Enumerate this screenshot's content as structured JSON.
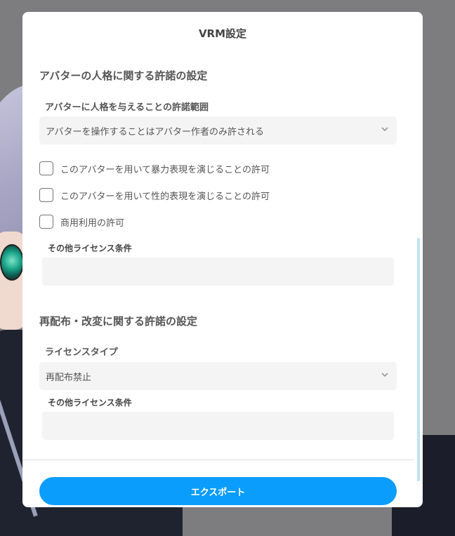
{
  "dialog": {
    "title": "VRM設定"
  },
  "personality": {
    "heading": "アバターの人格に関する許諾の設定",
    "scope_label": "アバターに人格を与えることの許諾範囲",
    "scope_value": "アバターを操作することはアバター作者のみ許される",
    "checkboxes": [
      {
        "label": "このアバターを用いて暴力表現を演じることの許可",
        "checked": false
      },
      {
        "label": "このアバターを用いて性的表現を演じることの許可",
        "checked": false
      },
      {
        "label": "商用利用の許可",
        "checked": false
      }
    ],
    "other_license_label": "その他ライセンス条件",
    "other_license_value": ""
  },
  "redistribution": {
    "heading": "再配布・改変に関する許諾の設定",
    "license_type_label": "ライセンスタイプ",
    "license_type_value": "再配布禁止",
    "other_license_label": "その他ライセンス条件",
    "other_license_value": ""
  },
  "footer": {
    "export_label": "エクスポート"
  },
  "colors": {
    "accent": "#0b9dfb",
    "field_bg": "#f4f4f4",
    "scrollbar": "#bfe2f3"
  },
  "icons": {
    "select_arrow": "chevron-down-icon"
  }
}
